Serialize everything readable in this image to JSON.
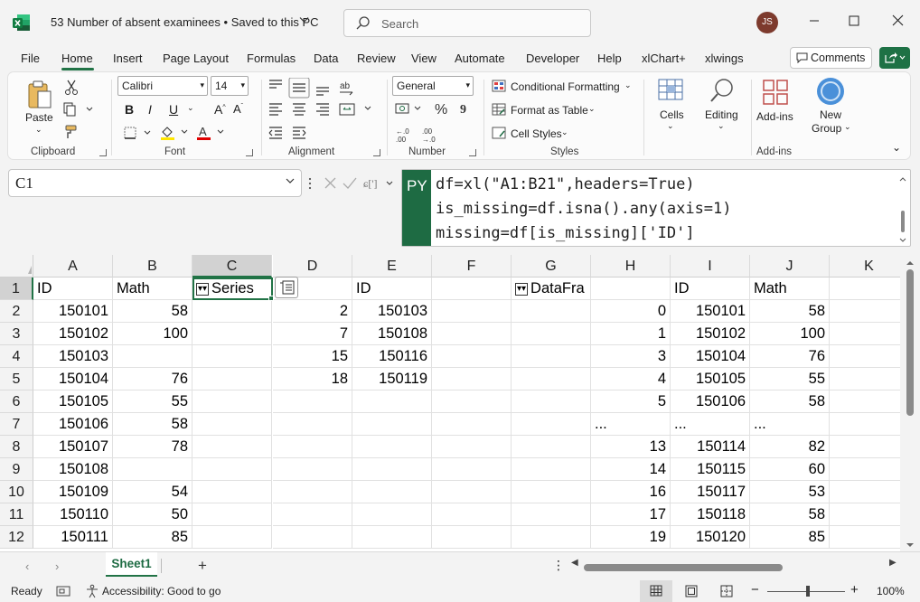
{
  "app": {
    "document_title": "53 Number of absent examinees",
    "save_status": "Saved to this PC",
    "search_placeholder": "Search",
    "user_initials": "JS"
  },
  "menu": {
    "tabs": [
      "File",
      "Home",
      "Insert",
      "Page Layout",
      "Formulas",
      "Data",
      "Review",
      "View",
      "Automate",
      "Developer",
      "Help",
      "xlChart+",
      "xlwings"
    ],
    "active_tab": "Home",
    "comments_label": "Comments"
  },
  "ribbon": {
    "clipboard": {
      "paste_label": "Paste",
      "group_label": "Clipboard"
    },
    "font": {
      "font_name": "Calibri",
      "font_size": "14",
      "group_label": "Font"
    },
    "alignment": {
      "group_label": "Alignment"
    },
    "number": {
      "format": "General",
      "group_label": "Number"
    },
    "styles": {
      "conditional_formatting": "Conditional Formatting",
      "format_as_table": "Format as Table",
      "cell_styles": "Cell Styles",
      "group_label": "Styles"
    },
    "cells_label": "Cells",
    "editing_label": "Editing",
    "addins_label": "Add-ins",
    "new_group_label_1": "New",
    "new_group_label_2": "Group",
    "addins_group_label": "Add-ins"
  },
  "formula_bar": {
    "name_box": "C1",
    "badge": "PY",
    "lines": [
      "df=xl(\"A1:B21\",headers=True)",
      "is_missing=df.isna().any(axis=1)",
      "missing=df[is_missing]['ID']"
    ]
  },
  "grid": {
    "columns": [
      "A",
      "B",
      "C",
      "D",
      "E",
      "F",
      "G",
      "H",
      "I",
      "J",
      "K"
    ],
    "selected_column": "C",
    "rows": [
      "1",
      "2",
      "3",
      "4",
      "5",
      "6",
      "7",
      "8",
      "9",
      "10",
      "11",
      "12"
    ],
    "cells": {
      "A1": "ID",
      "B1": "Math",
      "C1": "Series",
      "E1": "ID",
      "G1": "DataFra",
      "I1": "ID",
      "J1": "Math",
      "A2": "150101",
      "B2": "58",
      "D2": "2",
      "E2": "150103",
      "H2": "0",
      "I2": "150101",
      "J2": "58",
      "A3": "150102",
      "B3": "100",
      "D3": "7",
      "E3": "150108",
      "H3": "1",
      "I3": "150102",
      "J3": "100",
      "A4": "150103",
      "D4": "15",
      "E4": "150116",
      "H4": "3",
      "I4": "150104",
      "J4": "76",
      "A5": "150104",
      "B5": "76",
      "D5": "18",
      "E5": "150119",
      "H5": "4",
      "I5": "150105",
      "J5": "55",
      "A6": "150105",
      "B6": "55",
      "H6": "5",
      "I6": "150106",
      "J6": "58",
      "A7": "150106",
      "B7": "58",
      "H7": "...",
      "I7": "...",
      "J7": "...",
      "A8": "150107",
      "B8": "78",
      "H8": "13",
      "I8": "150114",
      "J8": "82",
      "A9": "150108",
      "H9": "14",
      "I9": "150115",
      "J9": "60",
      "A10": "150109",
      "B10": "54",
      "H10": "16",
      "I10": "150117",
      "J10": "53",
      "A11": "150110",
      "B11": "50",
      "H11": "17",
      "I11": "150118",
      "J11": "58",
      "A12": "150111",
      "B12": "85",
      "H12": "19",
      "I12": "150120",
      "J12": "85"
    }
  },
  "sheets": {
    "tabs": [
      "Sheet1"
    ],
    "active": "Sheet1"
  },
  "status": {
    "ready": "Ready",
    "accessibility": "Accessibility: Good to go",
    "zoom": "100%"
  },
  "colors": {
    "accent": "#217346",
    "python_badge": "#1e6b43"
  }
}
